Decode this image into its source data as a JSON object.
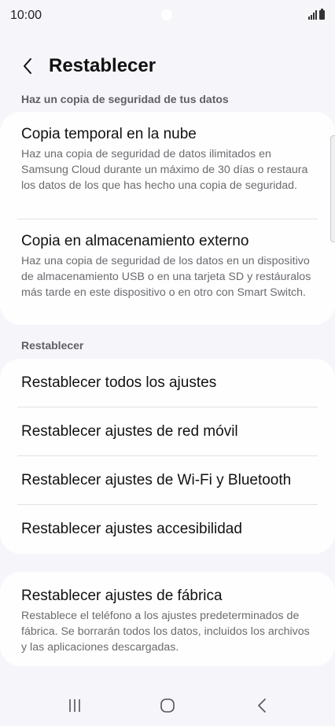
{
  "status_bar": {
    "time": "10:00",
    "signal": "signal-bars-icon",
    "battery": "battery-icon"
  },
  "header": {
    "title": "Restablecer",
    "back_icon": "back-chevron-icon"
  },
  "backup_section": {
    "label": "Haz un copia de seguridad de tus datos",
    "items": [
      {
        "title": "Copia temporal en la nube",
        "description": "Haz una copia de seguridad de datos ilimitados en Samsung Cloud durante un máximo de 30 días o restaura los datos de los que has hecho una copia de seguridad."
      },
      {
        "title": "Copia en almacenamiento externo",
        "description": "Haz una copia de seguridad de los datos en un dispositivo de almacenamiento USB o en una tarjeta SD y restáuralos más tarde en este dispositivo o en otro con Smart Switch."
      }
    ]
  },
  "reset_section": {
    "label": "Restablecer",
    "items": [
      {
        "title": "Restablecer todos los ajustes"
      },
      {
        "title": "Restablecer ajustes de red móvil"
      },
      {
        "title": "Restablecer ajustes de Wi-Fi y Bluetooth"
      },
      {
        "title": "Restablecer ajustes accesibilidad"
      }
    ]
  },
  "factory_reset": {
    "title": "Restablecer ajustes de fábrica",
    "description": "Restablece el teléfono a los ajustes predeterminados de fábrica. Se borrarán todos los datos, incluidos los archivos y las aplicaciones descargadas."
  },
  "nav_bar": {
    "recents": "recents-icon",
    "home": "home-icon",
    "back": "back-icon"
  }
}
